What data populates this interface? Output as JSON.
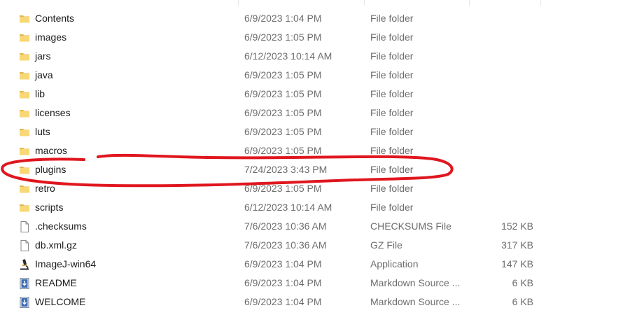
{
  "files": [
    {
      "name": "Contents",
      "date": "6/9/2023 1:04 PM",
      "type": "File folder",
      "size": "",
      "icon": "folder-icon"
    },
    {
      "name": "images",
      "date": "6/9/2023 1:05 PM",
      "type": "File folder",
      "size": "",
      "icon": "folder-icon"
    },
    {
      "name": "jars",
      "date": "6/12/2023 10:14 AM",
      "type": "File folder",
      "size": "",
      "icon": "folder-icon"
    },
    {
      "name": "java",
      "date": "6/9/2023 1:05 PM",
      "type": "File folder",
      "size": "",
      "icon": "folder-icon"
    },
    {
      "name": "lib",
      "date": "6/9/2023 1:05 PM",
      "type": "File folder",
      "size": "",
      "icon": "folder-icon"
    },
    {
      "name": "licenses",
      "date": "6/9/2023 1:05 PM",
      "type": "File folder",
      "size": "",
      "icon": "folder-icon"
    },
    {
      "name": "luts",
      "date": "6/9/2023 1:05 PM",
      "type": "File folder",
      "size": "",
      "icon": "folder-icon"
    },
    {
      "name": "macros",
      "date": "6/9/2023 1:05 PM",
      "type": "File folder",
      "size": "",
      "icon": "folder-icon"
    },
    {
      "name": "plugins",
      "date": "7/24/2023 3:43 PM",
      "type": "File folder",
      "size": "",
      "icon": "folder-icon",
      "highlighted": true
    },
    {
      "name": "retro",
      "date": "6/9/2023 1:05 PM",
      "type": "File folder",
      "size": "",
      "icon": "folder-icon"
    },
    {
      "name": "scripts",
      "date": "6/12/2023 10:14 AM",
      "type": "File folder",
      "size": "",
      "icon": "folder-icon"
    },
    {
      "name": ".checksums",
      "date": "7/6/2023 10:36 AM",
      "type": "CHECKSUMS File",
      "size": "152 KB",
      "icon": "file-icon"
    },
    {
      "name": "db.xml.gz",
      "date": "7/6/2023 10:36 AM",
      "type": "GZ File",
      "size": "317 KB",
      "icon": "file-icon"
    },
    {
      "name": "ImageJ-win64",
      "date": "6/9/2023 1:04 PM",
      "type": "Application",
      "size": "147 KB",
      "icon": "microscope-icon"
    },
    {
      "name": "README",
      "date": "6/9/2023 1:04 PM",
      "type": "Markdown Source ...",
      "size": "6 KB",
      "icon": "markdown-file-icon"
    },
    {
      "name": "WELCOME",
      "date": "6/9/2023 1:04 PM",
      "type": "Markdown Source ...",
      "size": "6 KB",
      "icon": "markdown-file-icon"
    }
  ],
  "colors": {
    "folder": "#f8d775",
    "folder_dark": "#e0b64c",
    "highlight_ring": "#e0161e"
  }
}
